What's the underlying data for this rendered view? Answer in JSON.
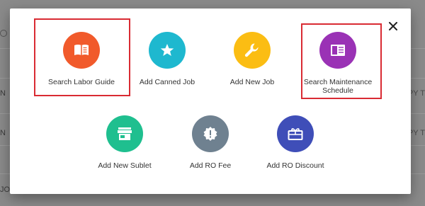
{
  "background": {
    "left_rows": [
      "N",
      "N",
      "JOI"
    ],
    "right_rows": [
      "OPY T",
      "OPY T"
    ]
  },
  "modal": {
    "actions": [
      {
        "label": "Search Labor Guide",
        "color": "#f15a2b",
        "icon": "book-icon"
      },
      {
        "label": "Add Canned Job",
        "color": "#1eb8cf",
        "icon": "star-icon"
      },
      {
        "label": "Add New Job",
        "color": "#fbbd13",
        "icon": "wrench-icon"
      },
      {
        "label": "Search Maintenance Schedule",
        "color": "#9a32b5",
        "icon": "schedule-book-icon"
      },
      {
        "label": "Add New Sublet",
        "color": "#1fbf8f",
        "icon": "store-icon"
      },
      {
        "label": "Add RO Fee",
        "color": "#6f8190",
        "icon": "fee-badge-icon"
      },
      {
        "label": "Add RO Discount",
        "color": "#3f4eb8",
        "icon": "gift-card-icon"
      }
    ],
    "highlight_color": "#d92b33"
  }
}
